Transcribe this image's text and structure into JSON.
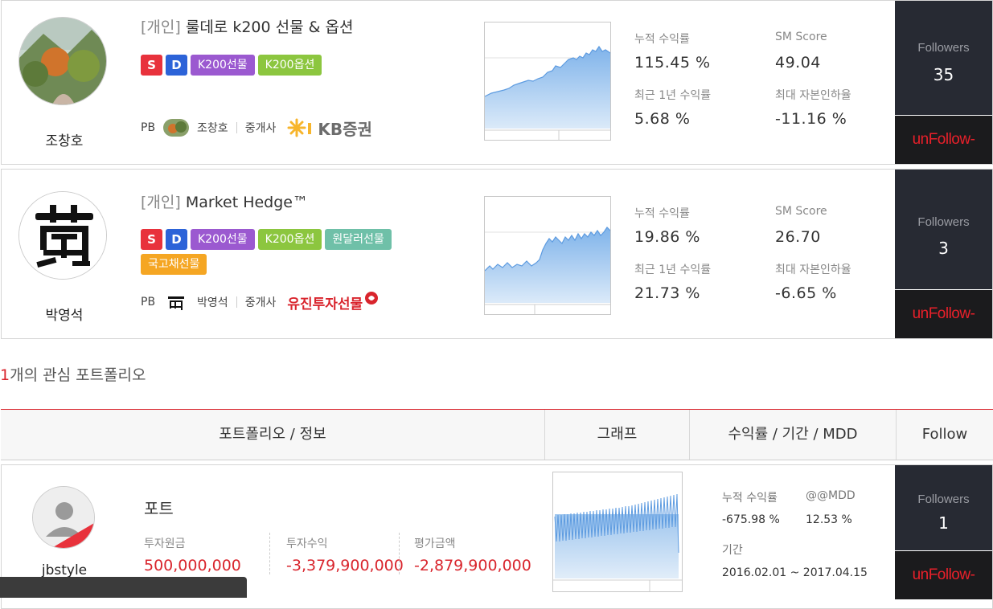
{
  "cards": [
    {
      "owner": "조창호",
      "title_tag": "[개인]",
      "title": "룰데로 k200 선물 & 옵션",
      "badges": [
        "S",
        "D",
        "K200선물",
        "K200옵션"
      ],
      "pb_label": "PB",
      "pb_name": "조창호",
      "broker_label": "중개사",
      "broker": "KB증권",
      "stats": {
        "cum_label": "누적 수익률",
        "cum_value": "115.45 %",
        "sm_label": "SM Score",
        "sm_value": "49.04",
        "year_label": "최근 1년 수익률",
        "year_value": "5.68 %",
        "mdd_label": "최대 자본인하율",
        "mdd_value": "-11.16 %"
      },
      "followers_label": "Followers",
      "followers": "35",
      "unfollow": "unFollow-"
    },
    {
      "owner": "박영석",
      "title_tag": "[개인]",
      "title": "Market Hedge™",
      "badges": [
        "S",
        "D",
        "K200선물",
        "K200옵션",
        "원달러선물",
        "국고채선물"
      ],
      "pb_label": "PB",
      "pb_name": "박영석",
      "broker_label": "중개사",
      "broker": "유진투자선물",
      "stats": {
        "cum_label": "누적 수익률",
        "cum_value": "19.86 %",
        "sm_label": "SM Score",
        "sm_value": "26.70",
        "year_label": "최근 1년 수익률",
        "year_value": "21.73 %",
        "mdd_label": "최대 자본인하율",
        "mdd_value": "-6.65 %"
      },
      "followers_label": "Followers",
      "followers": "3",
      "unfollow": "unFollow-"
    }
  ],
  "portfolio_count": "1",
  "portfolio_count_text": "개의 관심 포트폴리오",
  "table_headers": [
    "포트폴리오 / 정보",
    "그래프",
    "수익률 / 기간 / MDD",
    "Follow"
  ],
  "portfolio": {
    "owner": "jbstyle",
    "name": "포트",
    "principal_label": "투자원금",
    "principal": "500,000,000",
    "profit_label": "투자수익",
    "profit": "-3,379,900,000",
    "value_label": "평가금액",
    "value": "-2,879,900,000",
    "cum_label": "누적 수익률",
    "cum_value": "-675.98 %",
    "mdd_label": "@@MDD",
    "mdd_value": "12.53 %",
    "period_label": "기간",
    "period_value": "2016.02.01 ~ 2017.04.15",
    "followers_label": "Followers",
    "followers": "1",
    "unfollow": "unFollow-"
  },
  "colors": {
    "accent_red": "#d9252d",
    "badge_s": "#e8323c",
    "badge_d": "#2c63d8",
    "badge_k200f": "#9b59d0",
    "badge_k200o": "#8cc63f",
    "badge_usd": "#6fc0a8",
    "badge_bond": "#f5a623",
    "follow_panel": "#272a33"
  }
}
